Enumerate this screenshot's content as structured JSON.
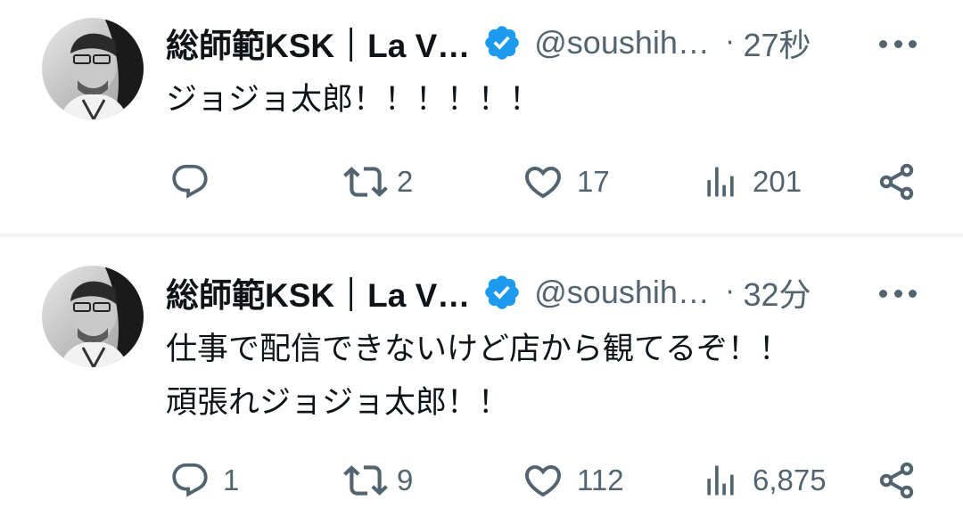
{
  "tweets": [
    {
      "author_name": "総師範KSK｜La V…",
      "handle": "@soushih…",
      "separator": "·",
      "time": "27秒",
      "text": "ジョジョ太郎！！！！！！",
      "counts": {
        "replies": "",
        "retweets": "2",
        "likes": "17",
        "views": "201"
      }
    },
    {
      "author_name": "総師範KSK｜La V…",
      "handle": "@soushih…",
      "separator": "·",
      "time": "32分",
      "text_line1": "仕事で配信できないけど店から観てるぞ！！",
      "text_line2": "頑張れジョジョ太郎！！",
      "counts": {
        "replies": "1",
        "retweets": "9",
        "likes": "112",
        "views": "6,875"
      }
    }
  ],
  "colors": {
    "text_primary": "#0f1419",
    "text_secondary": "#536471",
    "verified_badge": "#1d9bf0",
    "divider": "#eff3f4"
  },
  "icons": [
    "avatar-photo",
    "verified-badge-icon",
    "more-options-icon",
    "reply-icon",
    "retweet-icon",
    "like-icon",
    "views-icon",
    "share-icon"
  ]
}
